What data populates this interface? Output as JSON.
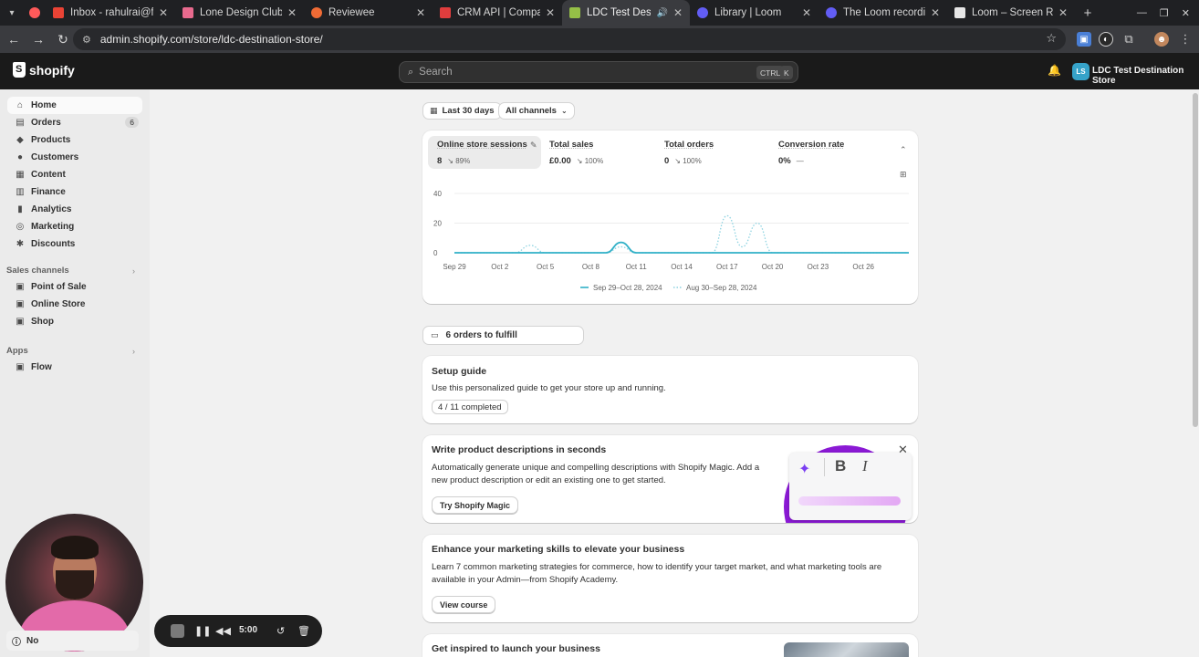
{
  "browser": {
    "tabs": [
      {
        "label": "Inbox - rahulrai@fo",
        "color": "#ea4335"
      },
      {
        "label": "Lone Design Club | T",
        "color": "#e86a8e"
      },
      {
        "label": "Reviewee",
        "color": "#f06b35"
      },
      {
        "label": "CRM API | Compani",
        "color": "#e03d3d"
      },
      {
        "label": "LDC Test Destina",
        "color": "#95bf47"
      },
      {
        "label": "Library | Loom",
        "color": "#625df5"
      },
      {
        "label": "The Loom recording",
        "color": "#625df5"
      },
      {
        "label": "Loom – Screen Rec",
        "color": "#e6e6e6"
      }
    ],
    "url": "admin.shopify.com/store/ldc-destination-store/"
  },
  "topbar": {
    "brand": "shopify",
    "search_placeholder": "Search",
    "shortcut_keys": [
      "CTRL",
      "K"
    ],
    "store_initials": "LS",
    "store_name": "LDC Test Destination Store"
  },
  "sidebar": {
    "items": [
      {
        "label": "Home",
        "icon": "home-icon"
      },
      {
        "label": "Orders",
        "icon": "orders-icon",
        "badge": "6"
      },
      {
        "label": "Products",
        "icon": "tag-icon"
      },
      {
        "label": "Customers",
        "icon": "person-icon"
      },
      {
        "label": "Content",
        "icon": "content-icon"
      },
      {
        "label": "Finance",
        "icon": "bank-icon"
      },
      {
        "label": "Analytics",
        "icon": "chart-bars-icon"
      },
      {
        "label": "Marketing",
        "icon": "target-icon"
      },
      {
        "label": "Discounts",
        "icon": "discount-icon"
      }
    ],
    "sales_channels_heading": "Sales channels",
    "sales_channels": [
      {
        "label": "Point of Sale"
      },
      {
        "label": "Online Store"
      },
      {
        "label": "Shop"
      }
    ],
    "apps_heading": "Apps",
    "apps": [
      {
        "label": "Flow"
      }
    ]
  },
  "filters": {
    "date_range": "Last 30 days",
    "channels": "All channels"
  },
  "metrics": [
    {
      "label": "Online store sessions",
      "value": "8",
      "change": "89%"
    },
    {
      "label": "Total sales",
      "value": "£0.00",
      "change": "100%"
    },
    {
      "label": "Total orders",
      "value": "0",
      "change": "100%"
    },
    {
      "label": "Conversion rate",
      "value": "0%",
      "change": "—"
    }
  ],
  "chart_data": {
    "type": "line",
    "x": [
      "Sep 29",
      "Oct 2",
      "Oct 5",
      "Oct 8",
      "Oct 11",
      "Oct 14",
      "Oct 17",
      "Oct 20",
      "Oct 23",
      "Oct 26"
    ],
    "y_ticks": [
      "40",
      "20",
      "0"
    ],
    "ylim": [
      0,
      40
    ],
    "series": [
      {
        "name": "Sep 29–Oct 28, 2024",
        "style": "solid",
        "color": "#30b0c7",
        "points": [
          [
            0,
            0
          ],
          [
            10,
            0
          ],
          [
            11,
            7
          ],
          [
            12,
            0
          ],
          [
            30,
            0
          ]
        ]
      },
      {
        "name": "Aug 30–Sep 28, 2024",
        "style": "dotted",
        "color": "#8ed3e1",
        "points": [
          [
            0,
            0
          ],
          [
            4,
            0
          ],
          [
            5,
            5
          ],
          [
            6,
            0
          ],
          [
            10,
            0
          ],
          [
            11,
            4
          ],
          [
            12,
            0
          ],
          [
            17,
            0
          ],
          [
            18,
            25
          ],
          [
            19,
            4
          ],
          [
            20,
            20
          ],
          [
            21,
            0
          ],
          [
            30,
            0
          ]
        ]
      }
    ],
    "grid": true,
    "legend": "bottom"
  },
  "fulfill": {
    "label": "6 orders to fulfill"
  },
  "setup_guide": {
    "title": "Setup guide",
    "text": "Use this personalized guide to get your store up and running.",
    "progress": "4 / 11 completed"
  },
  "magic_card": {
    "title": "Write product descriptions in seconds",
    "text_line1": "Automatically generate unique and compelling descriptions with Shopify Magic. Add a",
    "text_line2": "new product description or edit an existing one to get started.",
    "button": "Try Shopify Magic"
  },
  "marketing_card": {
    "title": "Enhance your marketing skills to elevate your business",
    "text_line1": "Learn 7 common marketing strategies for commerce, how to identify your target market, and what marketing tools are",
    "text_line2": "available in your Admin—from Shopify Academy.",
    "button": "View course"
  },
  "inspire_card": {
    "title": "Get inspired to launch your business"
  },
  "loom": {
    "timer": "5:00",
    "status_text": "No"
  }
}
